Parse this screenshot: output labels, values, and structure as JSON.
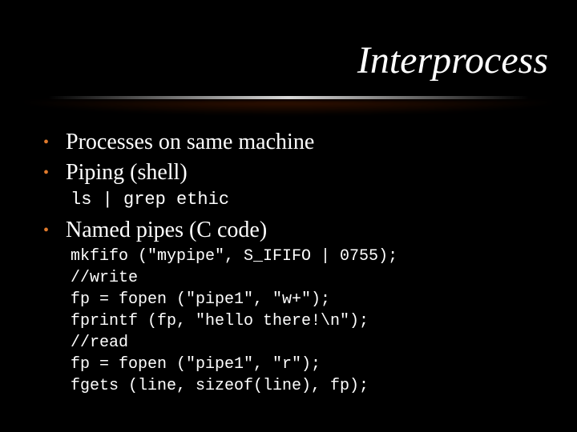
{
  "title": "Interprocess",
  "bullets": {
    "b1": "Processes on same machine",
    "b2": "Piping (shell)",
    "b3": "Named pipes (C code)"
  },
  "code": {
    "shell": "ls | grep ethic",
    "c0": "mkfifo (\"mypipe\", S_IFIFO | 0755);",
    "c1": "//write",
    "c2": "fp = fopen (\"pipe1\", \"w+\");",
    "c3": "fprintf (fp, \"hello there!\\n\");",
    "c4": "//read",
    "c5": "fp = fopen (\"pipe1\", \"r\");",
    "c6": "fgets (line, sizeof(line), fp);"
  }
}
